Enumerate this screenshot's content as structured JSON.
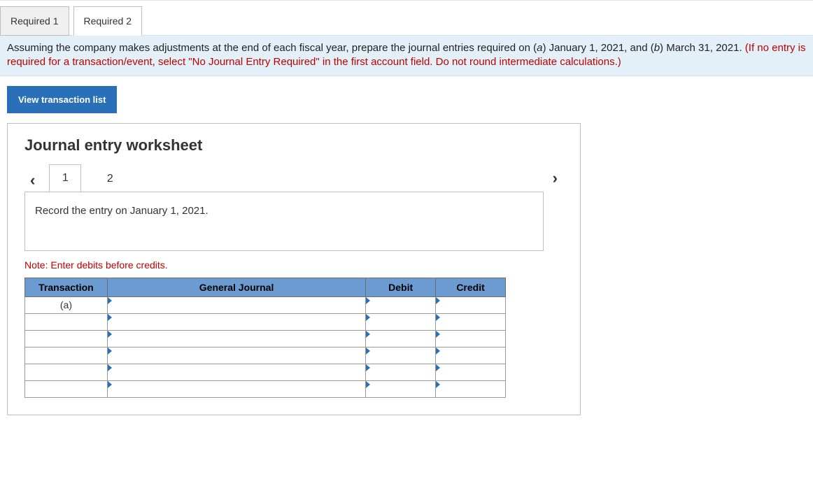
{
  "tabs": {
    "req1": "Required 1",
    "req2": "Required 2"
  },
  "instruction": {
    "black1": "Assuming the company makes adjustments at the end of each fiscal year, prepare the journal entries required on (",
    "italic_a": "a",
    "black2": ") January 1, 2021, and (",
    "italic_b": "b",
    "black3": ") March 31, 2021. ",
    "red": "(If no entry is required for a transaction/event, select \"No Journal Entry Required\" in the first account field. Do not round intermediate calculations.)"
  },
  "view_btn": "View transaction list",
  "worksheet": {
    "title": "Journal entry worksheet",
    "page1": "1",
    "page2": "2",
    "prompt": "Record the entry on January 1, 2021.",
    "note": "Note: Enter debits before credits.",
    "headers": {
      "txn": "Transaction",
      "gj": "General Journal",
      "debit": "Debit",
      "credit": "Credit"
    },
    "rows": [
      {
        "txn": "(a)"
      },
      {
        "txn": ""
      },
      {
        "txn": ""
      },
      {
        "txn": ""
      },
      {
        "txn": ""
      },
      {
        "txn": ""
      }
    ]
  }
}
